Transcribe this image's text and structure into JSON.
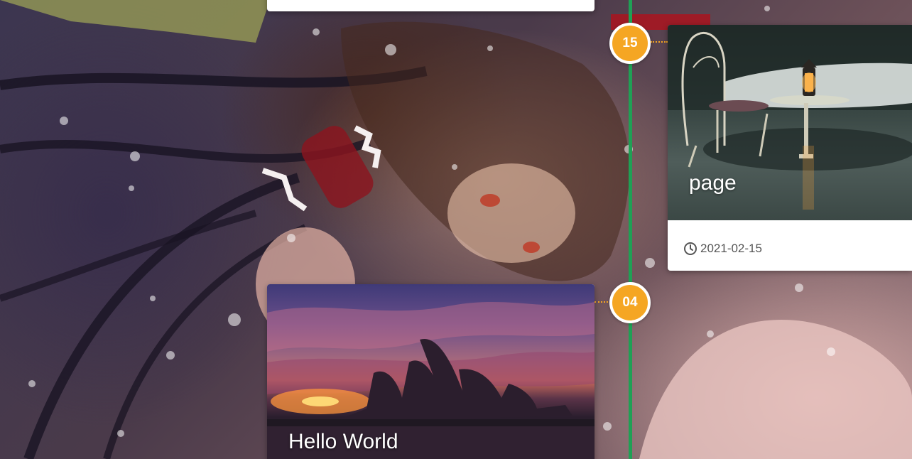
{
  "timeline": {
    "posts": [
      {
        "day": "15",
        "title": "page",
        "date": "2021-02-15",
        "date_icon": "clock-icon"
      },
      {
        "day": "04",
        "title": "Hello World"
      }
    ]
  },
  "colors": {
    "timeline_line": "#1fa055",
    "marker": "#f5a623",
    "card_background": "#ffffff"
  }
}
